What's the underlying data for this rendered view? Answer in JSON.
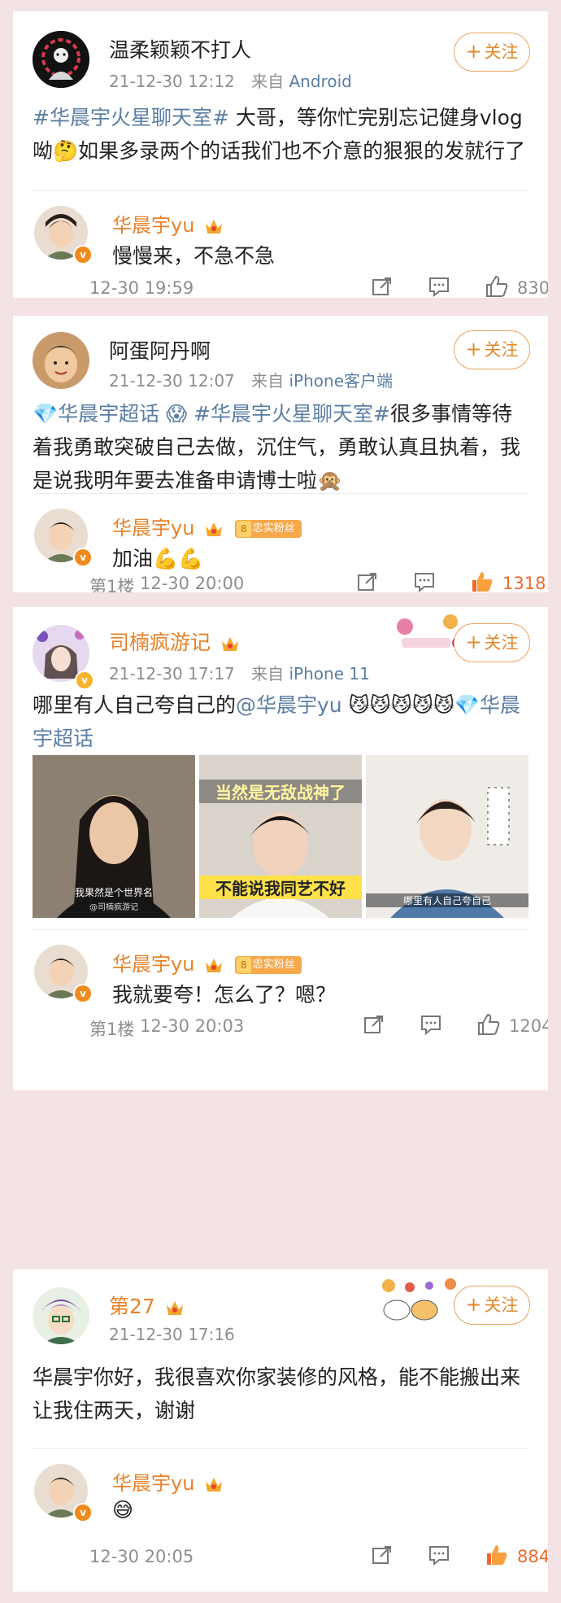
{
  "posts": [
    {
      "username": "温柔颖颖不打人",
      "time": "21-12-30 12:12",
      "source_prefix": "来自",
      "source": "Android",
      "follow_label": "关注",
      "text_topic": "#华晨宇火星聊天室#",
      "text_body": " 大哥，等你忙完别忘记健身vlog呦🤔如果多录两个的话我们也不介意的狠狠的发就行了",
      "reply": {
        "name": "华晨宇yu",
        "text": "慢慢来，不急不急",
        "floor": "",
        "time": "12-30 19:59",
        "likes": "830"
      }
    },
    {
      "username": "阿蛋阿丹啊",
      "time": "21-12-30 12:07",
      "source_prefix": "来自",
      "source": "iPhone客户端",
      "follow_label": "关注",
      "text_topic": "💎华晨宇超话 😱 #华晨宇火星聊天室#",
      "text_body": "很多事情等待着我勇敢突破自己去做，沉住气，勇敢认真且执着，我是说我明年要去准备申请博士啦🙊",
      "reply": {
        "name": "华晨宇yu",
        "fan_level": "8",
        "fan_label": "忠实粉丝",
        "text": "加油💪💪",
        "floor": "第1楼",
        "time": "12-30 20:00",
        "likes": "1318"
      }
    },
    {
      "username": "司楠疯游记",
      "time": "21-12-30 17:17",
      "source_prefix": "来自",
      "source": "iPhone 11",
      "follow_label": "关注",
      "text_plain": "哪里有人自己夸自己的",
      "text_mention": "@华晨宇yu",
      "text_emoji": " 😼😼😼😼😼",
      "text_topic2": "💎华晨宇超话",
      "images": [
        {
          "caption": "我果然是个世界名",
          "watermark": "@司楠疯游记"
        },
        {
          "caption_top": "当然是无敌战神了",
          "caption_bottom": "不能说我同艺不好"
        },
        {
          "caption": "哪里有人自己夸自己"
        }
      ],
      "reply": {
        "name": "华晨宇yu",
        "fan_level": "8",
        "fan_label": "忠实粉丝",
        "text": "我就要夸！怎么了？嗯？",
        "floor": "第1楼",
        "time": "12-30 20:03",
        "likes": "1204"
      }
    },
    {
      "username": "第27",
      "time": "21-12-30 17:16",
      "follow_label": "关注",
      "text_body": "华晨宇你好，我很喜欢你家装修的风格，能不能搬出来让我住两天，谢谢",
      "reply": {
        "name": "华晨宇yu",
        "text": "😅",
        "floor": "",
        "time": "12-30 20:05",
        "likes": "884"
      }
    }
  ],
  "colors": {
    "background": "#f4e3e4",
    "accent_orange": "#e8822a",
    "link_blue": "#5b7ea3",
    "meta_gray": "#8e8e8e",
    "liked_red": "#ee6a2b"
  },
  "icons": [
    "crown-badge-icon",
    "verified-v-icon",
    "share-icon",
    "comment-icon",
    "like-thumb-icon",
    "plus-icon"
  ]
}
